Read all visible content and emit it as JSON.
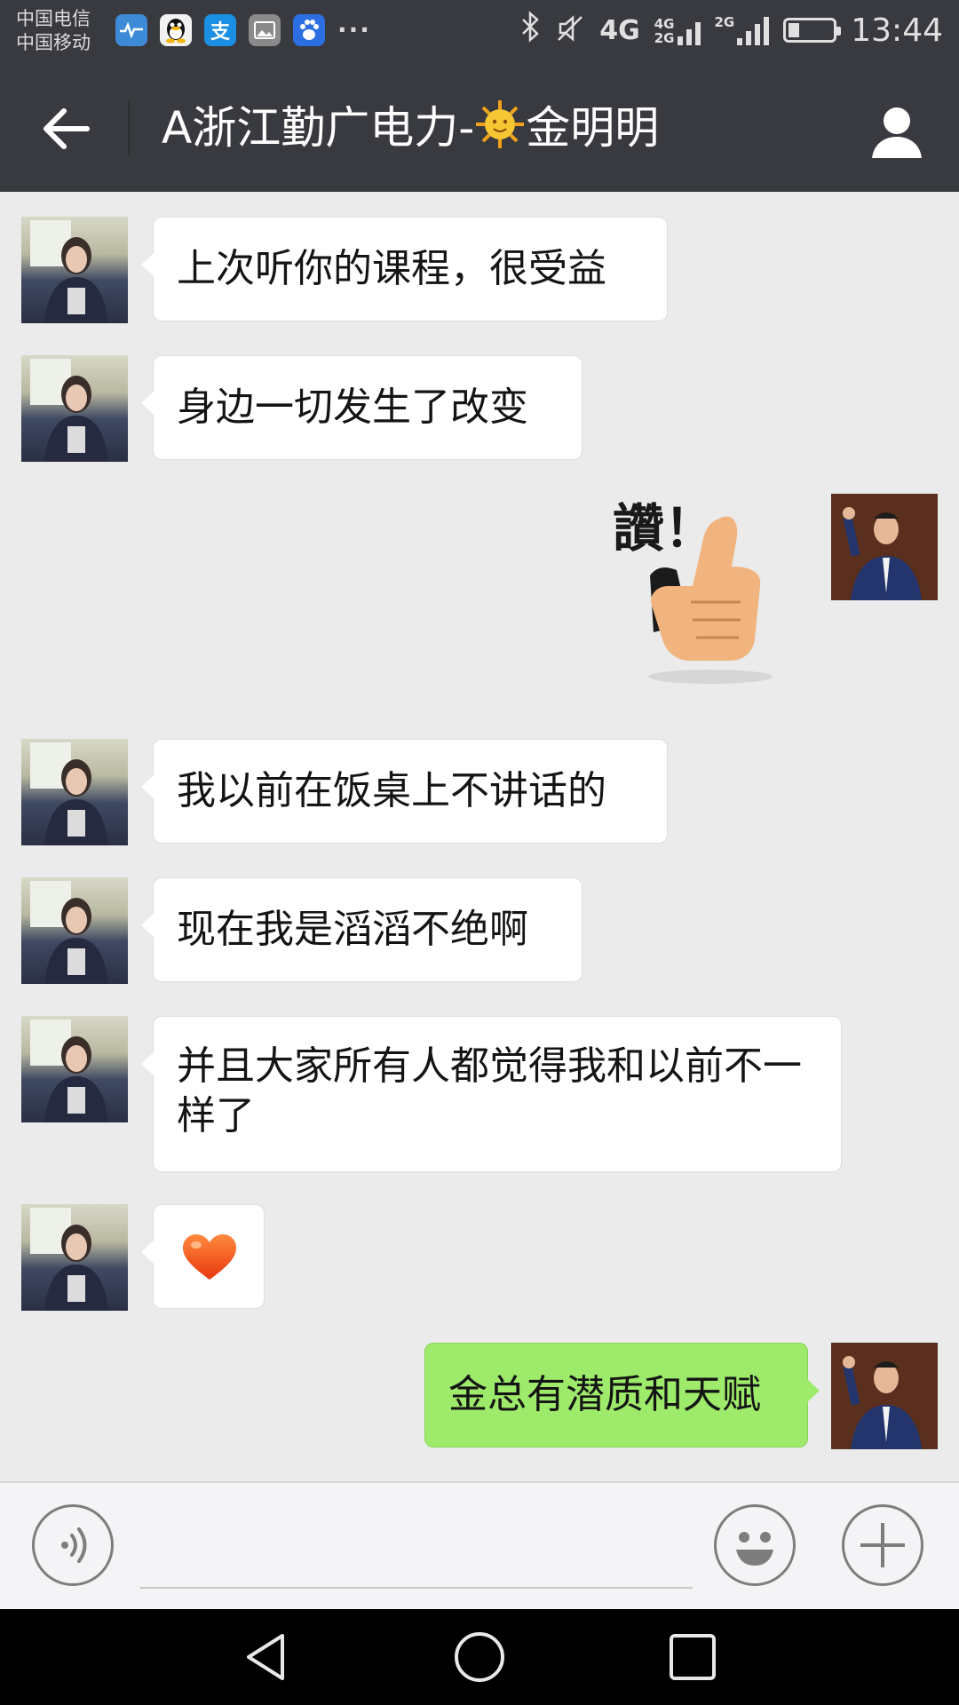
{
  "status_bar": {
    "carrier_1": "中国电信",
    "carrier_2": "中国移动",
    "notification_icons": [
      "health-icon",
      "qq-icon",
      "alipay-icon",
      "gallery-icon",
      "baidu-icon"
    ],
    "more": "···",
    "network_main": "4G",
    "network_top": "4G",
    "network_bottom": "2G",
    "network_3": "2G",
    "time": "13:44"
  },
  "header": {
    "title_prefix": "A浙江勤广电力-",
    "title_suffix": "金明明",
    "accent_color": "#393a3f"
  },
  "messages": [
    {
      "sender": "other",
      "text": "上次听你的课程，很受益"
    },
    {
      "sender": "other",
      "text": "身边一切发生了改变"
    },
    {
      "sender": "me",
      "type": "sticker",
      "text": "讚！"
    },
    {
      "sender": "other",
      "text": "我以前在饭桌上不讲话的"
    },
    {
      "sender": "other",
      "text": "现在我是滔滔不绝啊"
    },
    {
      "sender": "other",
      "text": "并且大家所有人都觉得我和以前不一样了"
    },
    {
      "sender": "other",
      "type": "emoji",
      "emoji": "heart-icon"
    },
    {
      "sender": "me",
      "text": "金总有潜质和天赋"
    }
  ],
  "colors": {
    "chat_bg": "#ebebeb",
    "bubble_me": "#9eea6a",
    "bubble_other": "#ffffff"
  }
}
